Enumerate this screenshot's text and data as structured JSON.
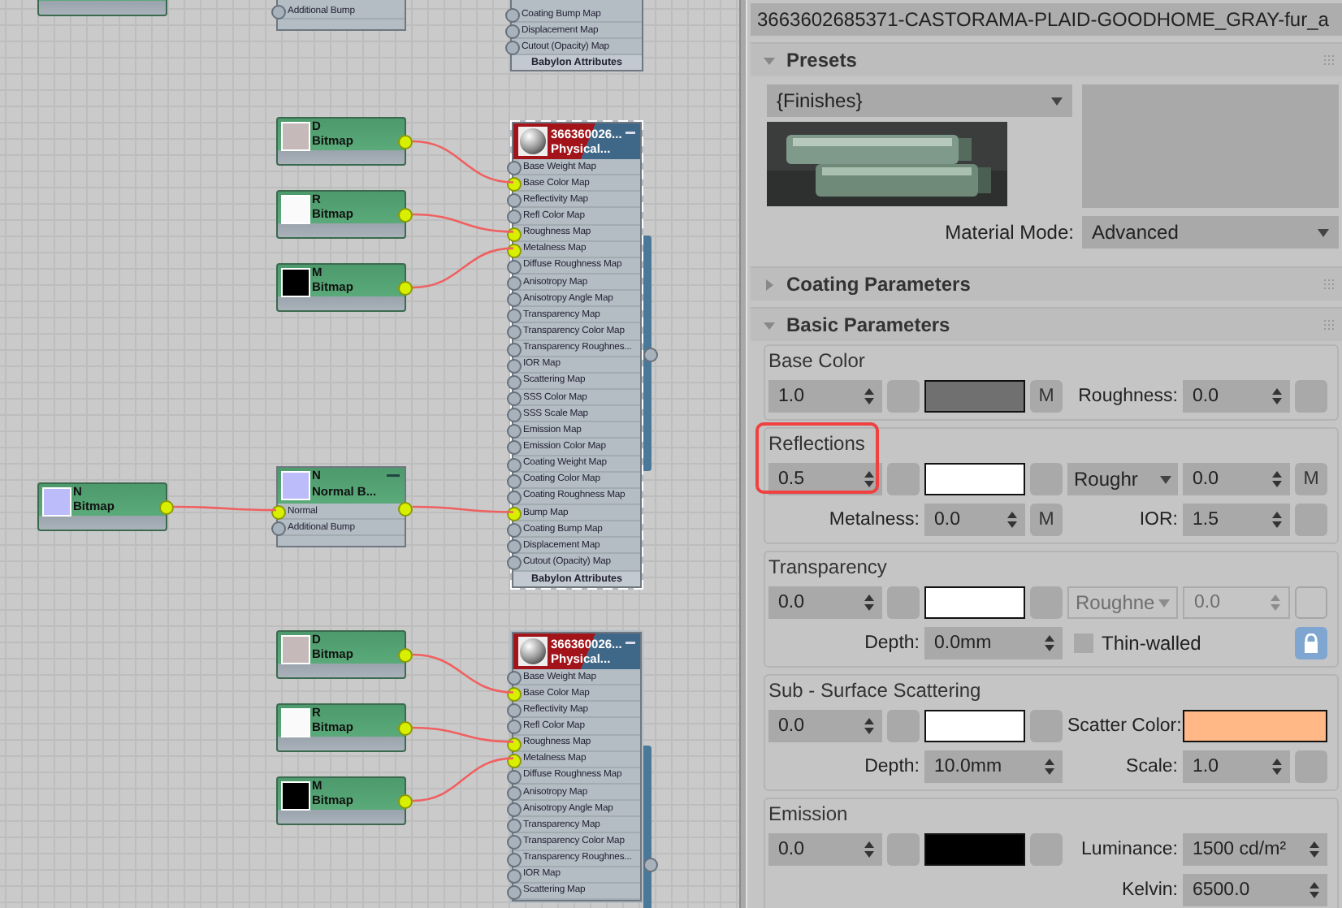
{
  "canvas": {
    "material_nodes": [
      {
        "kind": "partial",
        "slots": [
          {
            "label": "Coating Bump Map",
            "connected": false
          },
          {
            "label": "Displacement Map",
            "connected": false
          },
          {
            "label": "Cutout (Opacity) Map",
            "connected": false
          }
        ],
        "footer": "Babylon Attributes"
      },
      {
        "kind": "full",
        "title": "366360026...",
        "subtitle": "Physical...",
        "selected": true,
        "slots": [
          {
            "label": "Base Weight Map",
            "connected": false
          },
          {
            "label": "Base Color Map",
            "connected": true
          },
          {
            "label": "Reflectivity Map",
            "connected": false
          },
          {
            "label": "Refl Color Map",
            "connected": false
          },
          {
            "label": "Roughness Map",
            "connected": true
          },
          {
            "label": "Metalness Map",
            "connected": true
          },
          {
            "label": "Diffuse Roughness Map",
            "connected": false
          },
          {
            "label": "Anisotropy Map",
            "connected": false
          },
          {
            "label": "Anisotropy Angle Map",
            "connected": false
          },
          {
            "label": "Transparency Map",
            "connected": false
          },
          {
            "label": "Transparency Color Map",
            "connected": false
          },
          {
            "label": "Transparency Roughnes...",
            "connected": false
          },
          {
            "label": "IOR Map",
            "connected": false
          },
          {
            "label": "Scattering Map",
            "connected": false
          },
          {
            "label": "SSS Color Map",
            "connected": false
          },
          {
            "label": "SSS Scale Map",
            "connected": false
          },
          {
            "label": "Emission Map",
            "connected": false
          },
          {
            "label": "Emission Color Map",
            "connected": false
          },
          {
            "label": "Coating Weight Map",
            "connected": false
          },
          {
            "label": "Coating Color Map",
            "connected": false
          },
          {
            "label": "Coating Roughness Map",
            "connected": false
          },
          {
            "label": "Bump Map",
            "connected": true
          },
          {
            "label": "Coating Bump Map",
            "connected": false
          },
          {
            "label": "Displacement Map",
            "connected": false
          },
          {
            "label": "Cutout (Opacity) Map",
            "connected": false
          }
        ],
        "footer": "Babylon Attributes"
      },
      {
        "kind": "full",
        "title": "366360026...",
        "subtitle": "Physical...",
        "selected": false,
        "slots": [
          {
            "label": "Base Weight Map",
            "connected": false
          },
          {
            "label": "Base Color Map",
            "connected": true
          },
          {
            "label": "Reflectivity Map",
            "connected": false
          },
          {
            "label": "Refl Color Map",
            "connected": false
          },
          {
            "label": "Roughness Map",
            "connected": true
          },
          {
            "label": "Metalness Map",
            "connected": true
          },
          {
            "label": "Diffuse Roughness Map",
            "connected": false
          },
          {
            "label": "Anisotropy Map",
            "connected": false
          },
          {
            "label": "Anisotropy Angle Map",
            "connected": false
          },
          {
            "label": "Transparency Map",
            "connected": false
          },
          {
            "label": "Transparency Color Map",
            "connected": false
          },
          {
            "label": "Transparency Roughnes...",
            "connected": false
          },
          {
            "label": "IOR Map",
            "connected": false
          },
          {
            "label": "Scattering Map",
            "connected": false
          }
        ]
      }
    ],
    "map_nodes": [
      {
        "kind": "partial_bitmap"
      },
      {
        "kind": "partial_normal",
        "slots": [
          {
            "label": "Additional Bump",
            "connected": false
          }
        ]
      },
      {
        "kind": "bitmap",
        "letter": "D",
        "label": "Bitmap",
        "color": "#c6b9b9",
        "output_connected": true
      },
      {
        "kind": "bitmap",
        "letter": "R",
        "label": "Bitmap",
        "color": "#fafafa",
        "output_connected": true
      },
      {
        "kind": "bitmap",
        "letter": "M",
        "label": "Bitmap",
        "color": "#000000",
        "output_connected": true
      },
      {
        "kind": "bitmap",
        "letter": "N",
        "label": "Bitmap",
        "color": "#bcbcfa",
        "output_connected": true
      },
      {
        "kind": "normal_bump",
        "letter": "N",
        "label": "Normal B...",
        "color": "#bcbcfa",
        "output_connected": true,
        "slots": [
          {
            "label": "Normal",
            "connected": true
          },
          {
            "label": "Additional Bump",
            "connected": false
          }
        ]
      },
      {
        "kind": "bitmap",
        "letter": "D",
        "label": "Bitmap",
        "color": "#c6b9b9",
        "output_connected": true
      },
      {
        "kind": "bitmap",
        "letter": "R",
        "label": "Bitmap",
        "color": "#fafafa",
        "output_connected": true
      },
      {
        "kind": "bitmap",
        "letter": "M",
        "label": "Bitmap",
        "color": "#000000",
        "output_connected": true
      }
    ]
  },
  "material_name": "3663602685371-CASTORAMA-PLAID-GOODHOME_GRAY-fur_a",
  "rollouts": [
    {
      "kind": "presets",
      "title": "Presets",
      "expanded": true,
      "preset": "{Finishes}",
      "mode_label": "Material Mode:",
      "mode": "Advanced"
    },
    {
      "kind": "simple",
      "title": "Coating Parameters",
      "expanded": false
    },
    {
      "kind": "basic",
      "title": "Basic Parameters",
      "expanded": true,
      "groups": [
        {
          "title": "Base Color",
          "highlighted": false,
          "rows": [
            [
              {
                "kind": "spinner",
                "value": "1.0"
              },
              {
                "kind": "button"
              },
              {
                "kind": "swatch",
                "color": "#707070"
              },
              {
                "kind": "button",
                "text": "M"
              },
              {
                "kind": "label",
                "text": "Roughness:"
              },
              {
                "kind": "spinner",
                "value": "0.0"
              },
              {
                "kind": "button"
              }
            ]
          ]
        },
        {
          "title": "Reflections",
          "highlighted": true,
          "rows": [
            [
              {
                "kind": "spinner",
                "value": "0.5"
              },
              {
                "kind": "button"
              },
              {
                "kind": "swatch",
                "color": "#ffffff"
              },
              {
                "kind": "button"
              },
              {
                "kind": "dropdown",
                "value": "Roughr"
              },
              {
                "kind": "spinner",
                "value": "0.0"
              },
              {
                "kind": "button",
                "text": "M"
              }
            ],
            [
              "",
              {
                "kind": "label",
                "text": "Metalness:"
              },
              {
                "kind": "spinner",
                "value": "0.0"
              },
              {
                "kind": "button",
                "text": "M"
              },
              {
                "kind": "label",
                "text": "IOR:"
              },
              {
                "kind": "spinner",
                "value": "1.5"
              },
              {
                "kind": "button"
              }
            ]
          ]
        },
        {
          "title": "Transparency",
          "highlighted": false,
          "rows": [
            [
              {
                "kind": "spinner",
                "value": "0.0",
                "disabled": false
              },
              {
                "kind": "button",
                "disabled": false
              },
              {
                "kind": "swatch",
                "color": "#ffffff"
              },
              {
                "kind": "button",
                "disabled": false
              },
              {
                "kind": "dropdown",
                "value": "Roughne",
                "disabled": true
              },
              {
                "kind": "spinner",
                "value": "0.0",
                "disabled": true
              },
              {
                "kind": "button",
                "disabled": true
              }
            ],
            [
              "",
              {
                "kind": "label",
                "text": "Depth:"
              },
              {
                "kind": "spinner",
                "value": "0.0mm"
              },
              "",
              {
                "kind": "checkbox",
                "label": "Thin-walled",
                "checked": false
              },
              "",
              {
                "kind": "lock"
              }
            ]
          ]
        },
        {
          "title": "Sub - Surface Scattering",
          "highlighted": false,
          "rows": [
            [
              {
                "kind": "spinner",
                "value": "0.0"
              },
              {
                "kind": "button"
              },
              {
                "kind": "swatch",
                "color": "#ffffff"
              },
              {
                "kind": "button"
              },
              {
                "kind": "label",
                "text": "Scatter Color:"
              },
              {
                "kind": "swatch",
                "color": "#ffb886"
              }
            ],
            [
              "",
              {
                "kind": "label",
                "text": "Depth:"
              },
              {
                "kind": "spinner",
                "value": "10.0mm"
              },
              "",
              {
                "kind": "label",
                "text": "Scale:"
              },
              {
                "kind": "spinner",
                "value": "1.0"
              },
              {
                "kind": "button"
              }
            ]
          ]
        },
        {
          "title": "Emission",
          "highlighted": false,
          "rows": [
            [
              {
                "kind": "spinner",
                "value": "0.0"
              },
              {
                "kind": "button"
              },
              {
                "kind": "swatch",
                "color": "#000000"
              },
              {
                "kind": "button"
              },
              {
                "kind": "label",
                "text": "Luminance:"
              },
              {
                "kind": "spinner",
                "value": "1500 cd/m²"
              }
            ],
            [
              "",
              "",
              "",
              "",
              {
                "kind": "label",
                "text": "Kelvin:"
              },
              {
                "kind": "spinner",
                "value": "6500.0"
              }
            ]
          ]
        }
      ]
    }
  ]
}
